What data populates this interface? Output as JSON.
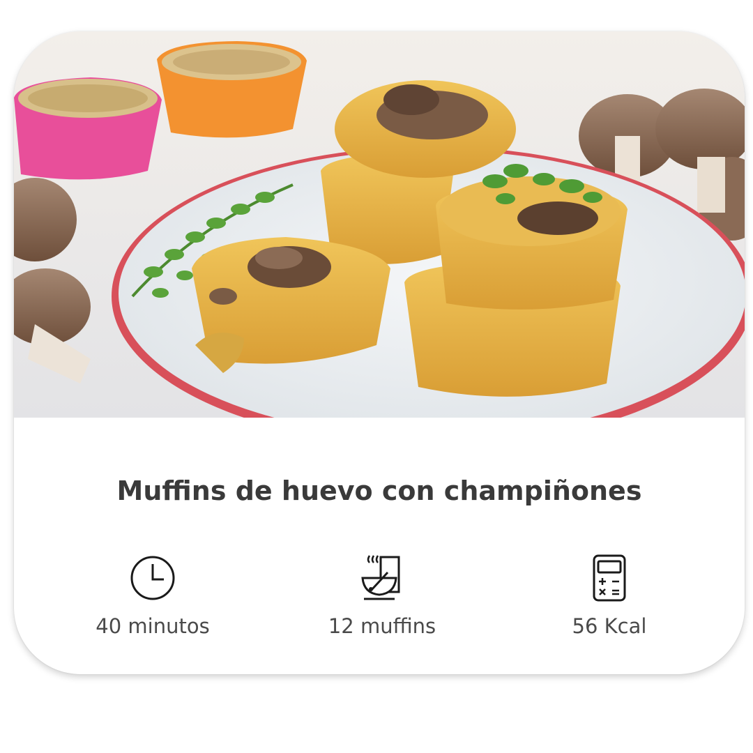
{
  "recipe_card": {
    "title": "Muffins de huevo con champiñones",
    "image_alt": "Muffins de huevo con champiñones en un plato",
    "stats": [
      {
        "icon": "clock-icon",
        "label": "40 minutos"
      },
      {
        "icon": "mixing-bowl-icon",
        "label": "12 muffins"
      },
      {
        "icon": "calculator-icon",
        "label": "56 Kcal"
      }
    ]
  },
  "colors": {
    "title_text": "#3a3a3a",
    "stat_text": "#4a4a4a",
    "plate_rim": "#d8505a",
    "muffin": "#e8b84a"
  }
}
